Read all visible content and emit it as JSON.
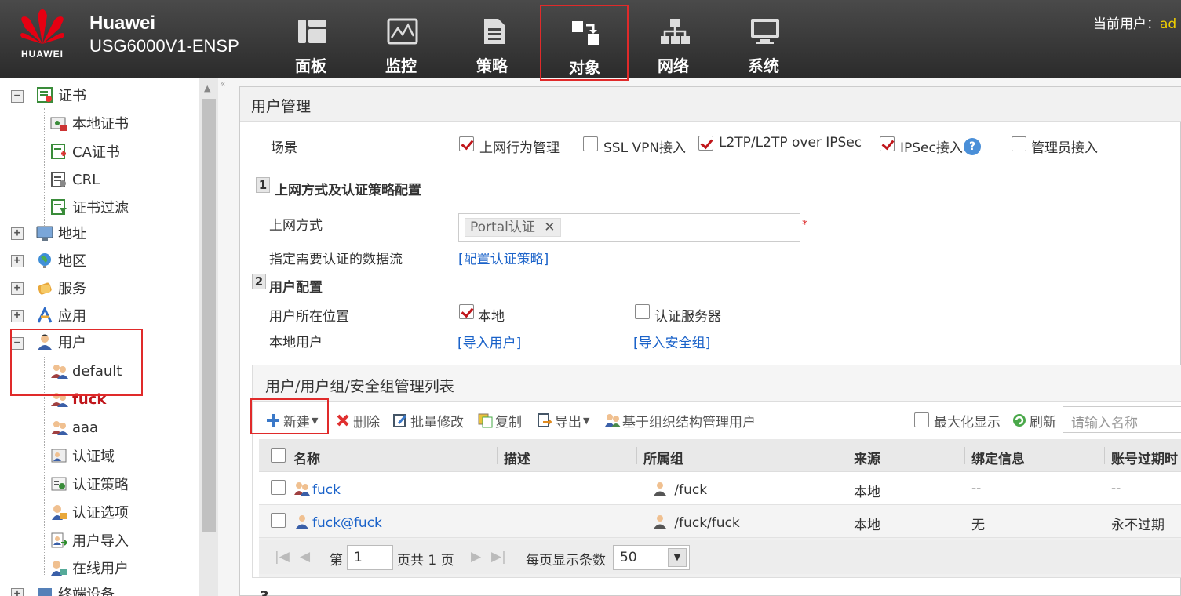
{
  "header": {
    "brand": "HUAWEI",
    "product_line1": "Huawei",
    "product_line2": "USG6000V1-ENSP",
    "nav": [
      {
        "label": "面板",
        "icon": "dashboard-icon"
      },
      {
        "label": "监控",
        "icon": "monitor-icon"
      },
      {
        "label": "策略",
        "icon": "policy-icon"
      },
      {
        "label": "对象",
        "icon": "object-icon",
        "active": true
      },
      {
        "label": "网络",
        "icon": "network-icon"
      },
      {
        "label": "系统",
        "icon": "system-icon"
      }
    ],
    "current_user_label": "当前用户：",
    "current_user_value": "ad"
  },
  "sidebar": {
    "items": [
      {
        "label": "证书",
        "expander": "−",
        "icon": "certificate-icon"
      },
      {
        "label": "本地证书",
        "icon": "local-certificate-icon"
      },
      {
        "label": "CA证书",
        "icon": "ca-certificate-icon"
      },
      {
        "label": "CRL",
        "icon": "crl-icon"
      },
      {
        "label": "证书过滤",
        "icon": "certificate-filter-icon"
      },
      {
        "label": "地址",
        "expander": "+",
        "icon": "address-icon"
      },
      {
        "label": "地区",
        "expander": "+",
        "icon": "region-icon"
      },
      {
        "label": "服务",
        "expander": "+",
        "icon": "service-icon"
      },
      {
        "label": "应用",
        "expander": "+",
        "icon": "application-icon"
      },
      {
        "label": "用户",
        "expander": "−",
        "icon": "user-icon"
      },
      {
        "label": "default",
        "icon": "user-group-icon"
      },
      {
        "label": "fuck",
        "icon": "user-group-icon",
        "highlight": true
      },
      {
        "label": "aaa",
        "icon": "user-group-icon"
      },
      {
        "label": "认证域",
        "icon": "auth-domain-icon"
      },
      {
        "label": "认证策略",
        "icon": "auth-policy-icon"
      },
      {
        "label": "认证选项",
        "icon": "auth-option-icon"
      },
      {
        "label": "用户导入",
        "icon": "user-import-icon"
      },
      {
        "label": "在线用户",
        "icon": "online-user-icon"
      },
      {
        "label": "终端设备",
        "expander": "+",
        "icon": "terminal-icon"
      }
    ]
  },
  "main": {
    "title": "用户管理",
    "scene": {
      "label": "场景",
      "options": [
        {
          "label": "上网行为管理",
          "checked": true
        },
        {
          "label": "SSL VPN接入",
          "checked": false
        },
        {
          "label": "L2TP/L2TP over IPSec",
          "checked": true
        },
        {
          "label": "IPSec接入",
          "checked": true
        },
        {
          "label": "管理员接入",
          "checked": false
        }
      ]
    },
    "section1": {
      "num": "1",
      "title": "上网方式及认证策略配置",
      "access_label": "上网方式",
      "access_tag": "Portal认证",
      "required_mark": "*",
      "flow_label": "指定需要认证的数据流",
      "flow_link": "[配置认证策略]"
    },
    "section2": {
      "num": "2",
      "title": "用户配置",
      "location_label": "用户所在位置",
      "location_local": "本地",
      "location_local_checked": true,
      "location_server": "认证服务器",
      "location_server_checked": false,
      "local_users_label": "本地用户",
      "import_users": "[导入用户]",
      "import_groups": "[导入安全组]"
    },
    "list": {
      "title": "用户/用户组/安全组管理列表",
      "toolbar": {
        "new": "新建",
        "delete": "删除",
        "batch_edit": "批量修改",
        "copy": "复制",
        "export": "导出",
        "org_manage": "基于组织结构管理用户",
        "maximize": "最大化显示",
        "refresh": "刷新",
        "search_placeholder": "请输入名称"
      },
      "columns": [
        "名称",
        "描述",
        "所属组",
        "来源",
        "绑定信息",
        "账号过期时"
      ],
      "rows": [
        {
          "name": "fuck",
          "desc": "",
          "group": "/fuck",
          "source": "本地",
          "binding": "--",
          "expire": "--"
        },
        {
          "name": "fuck@fuck",
          "desc": "",
          "group": "/fuck/fuck",
          "source": "本地",
          "binding": "无",
          "expire": "永不过期"
        }
      ],
      "pager": {
        "page_prefix": "第",
        "page_value": "1",
        "page_suffix": "页共 1 页",
        "per_page_label": "每页显示条数",
        "per_page_value": "50"
      }
    },
    "section3_num": "3"
  },
  "colors": {
    "header_bg": "#333333",
    "accent_red": "#e02a2a",
    "link": "#1a62c9",
    "check": "#c0161b"
  }
}
